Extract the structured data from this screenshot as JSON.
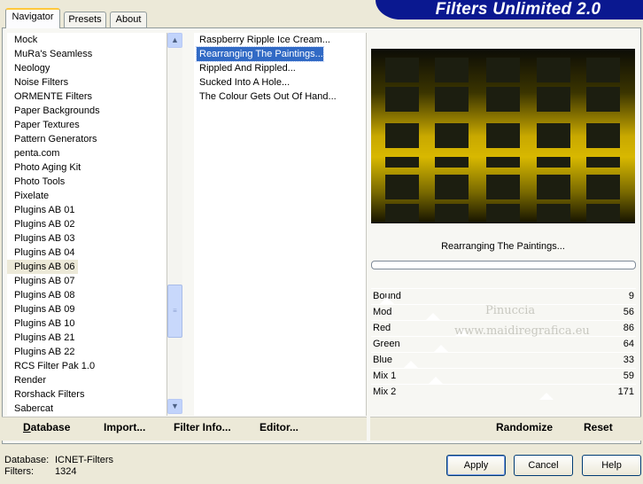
{
  "app": {
    "banner": "Filters Unlimited 2.0"
  },
  "tabs": [
    {
      "label": "Navigator"
    },
    {
      "label": "Presets"
    },
    {
      "label": "About"
    }
  ],
  "categories": [
    "Mock",
    "MuRa's Seamless",
    "Neology",
    "Noise Filters",
    "ORMENTE Filters",
    "Paper Backgrounds",
    "Paper Textures",
    "Pattern Generators",
    "penta.com",
    "Photo Aging Kit",
    "Photo Tools",
    "Pixelate",
    "Plugins AB 01",
    "Plugins AB 02",
    "Plugins AB 03",
    "Plugins AB 04",
    "Plugins AB 06",
    "Plugins AB 07",
    "Plugins AB 08",
    "Plugins AB 09",
    "Plugins AB 10",
    "Plugins AB 21",
    "Plugins AB 22",
    "RCS Filter Pak 1.0",
    "Render",
    "Rorshack Filters",
    "Sabercat"
  ],
  "selected_category": "Plugins AB 06",
  "filters": [
    "Raspberry Ripple Ice Cream...",
    "Rearranging The Paintings...",
    "Rippled And Rippled...",
    "Sucked Into A Hole...",
    "The Colour Gets Out Of Hand..."
  ],
  "selected_filter": "Rearranging The Paintings...",
  "preview": {
    "filter_name": "Rearranging The Paintings..."
  },
  "sliders": [
    {
      "name": "Bound",
      "value": 9
    },
    {
      "name": "Mod",
      "value": 56
    },
    {
      "name": "Red",
      "value": 86
    },
    {
      "name": "Green",
      "value": 64
    },
    {
      "name": "Blue",
      "value": 33
    },
    {
      "name": "Mix 1",
      "value": 59
    },
    {
      "name": "Mix 2",
      "value": 171
    }
  ],
  "watermark": {
    "line1": "Pinuccia",
    "line2": "www.maidiregrafica.eu"
  },
  "toolbar": {
    "database": "Database",
    "import": "Import...",
    "filter_info": "Filter Info...",
    "editor": "Editor...",
    "randomize": "Randomize",
    "reset": "Reset"
  },
  "status": {
    "database_label": "Database:",
    "database_value": "ICNET-Filters",
    "filters_label": "Filters:",
    "filters_value": "1324"
  },
  "buttons": {
    "apply": "Apply",
    "cancel": "Cancel",
    "help": "Help"
  },
  "colors": {
    "banner": "#0a1890",
    "selection": "#316ac5",
    "preview_yellow": "#c8a800"
  }
}
